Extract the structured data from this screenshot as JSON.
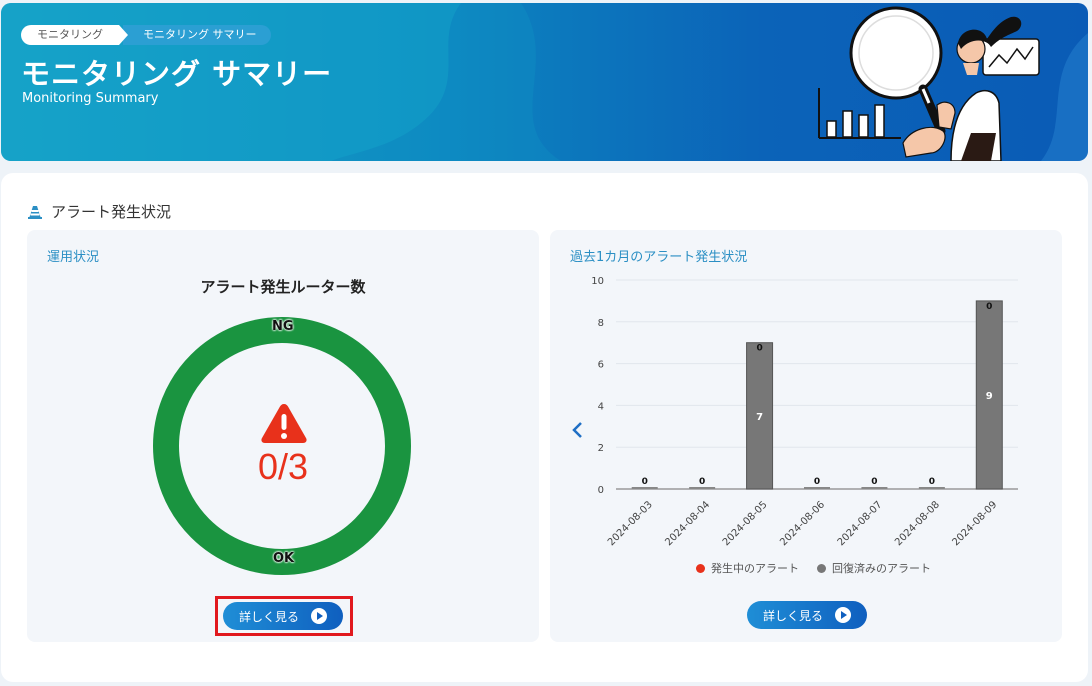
{
  "header": {
    "breadcrumb": [
      "モニタリング",
      "モニタリング サマリー"
    ],
    "title": "モニタリング サマリー",
    "subtitle": "Monitoring Summary"
  },
  "section": {
    "title": "アラート発生状況",
    "icon": "traffic-cone-icon"
  },
  "left_panel": {
    "label": "運用状況",
    "gauge_title": "アラート発生ルーター数",
    "ng_label": "NG",
    "ok_label": "OK",
    "ratio": "0/3",
    "ng_count": 0,
    "total": 3,
    "ring_color": "#1a9440",
    "alert_color": "#e8311b",
    "button_label": "詳しく見る"
  },
  "right_panel": {
    "label": "過去1カ月のアラート発生状況",
    "button_label": "詳しく見る"
  },
  "chart_data": {
    "type": "bar",
    "categories": [
      "2024-08-03",
      "2024-08-04",
      "2024-08-05",
      "2024-08-06",
      "2024-08-07",
      "2024-08-08",
      "2024-08-09"
    ],
    "series": [
      {
        "name": "発生中のアラート",
        "color": "#e8311b",
        "values": [
          0,
          0,
          0,
          0,
          0,
          0,
          0
        ]
      },
      {
        "name": "回復済みのアラート",
        "color": "#777777",
        "values": [
          0,
          0,
          7,
          0,
          0,
          0,
          9
        ]
      }
    ],
    "ylim": [
      0,
      10
    ],
    "yticks": [
      0,
      2,
      4,
      6,
      8,
      10
    ],
    "stacked": true,
    "grid": true,
    "legend": "bottom"
  }
}
